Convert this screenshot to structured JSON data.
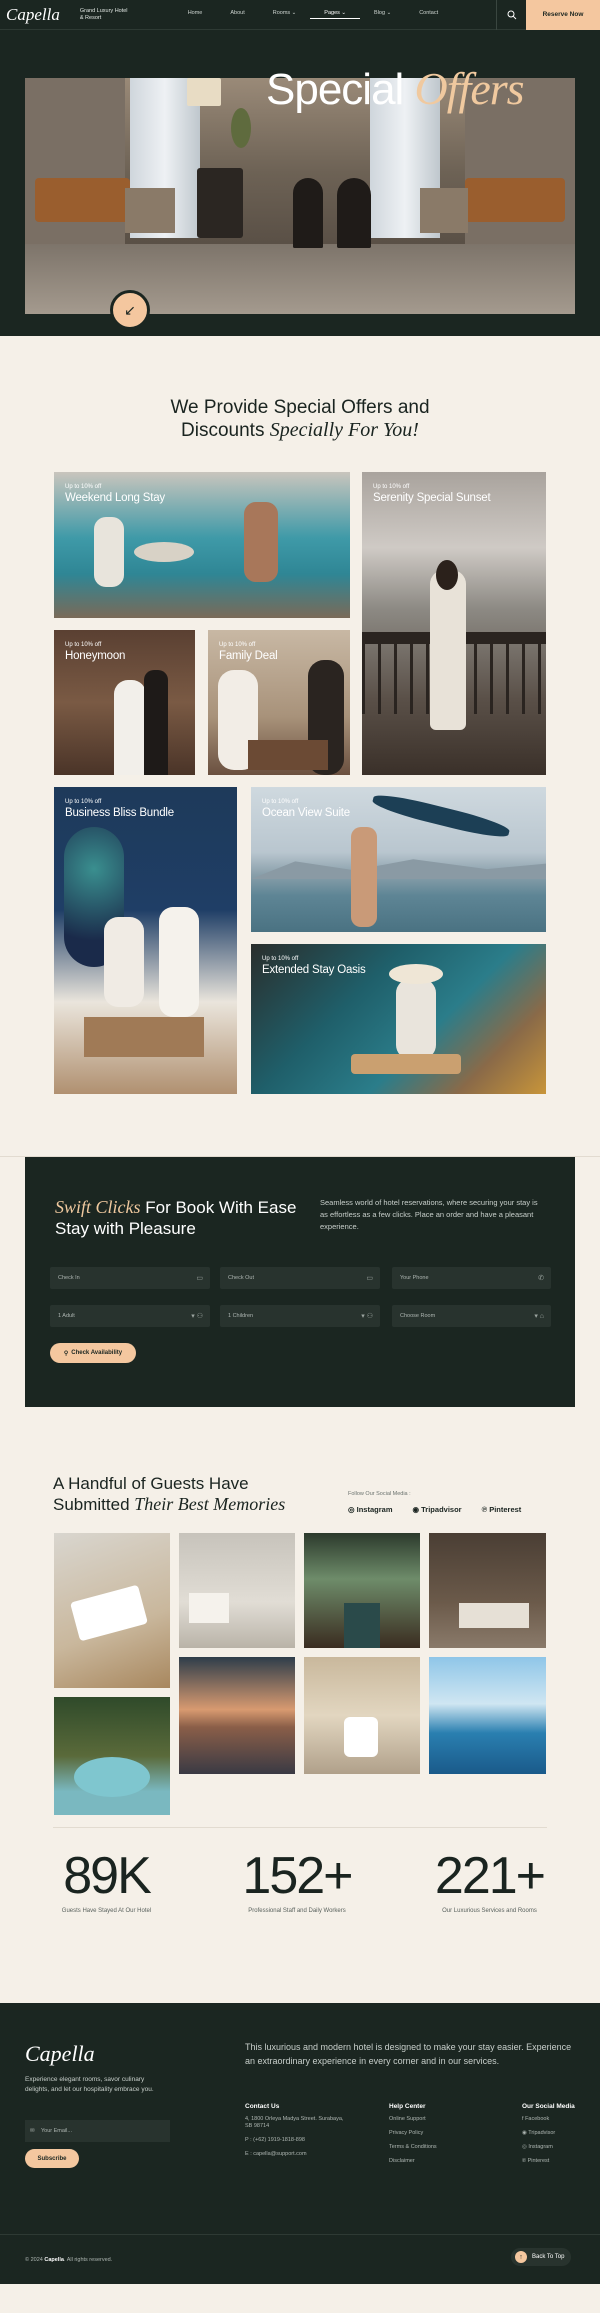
{
  "header": {
    "logo": "Capella",
    "tagline": "Grand Luxury Hotel & Resort",
    "nav": [
      "Home",
      "About",
      "Rooms ⌄",
      "Pages ⌄",
      "Blog ⌄",
      "Contact"
    ],
    "reserve": "Reserve Now"
  },
  "hero": {
    "title_plain": "Special",
    "title_italic": "Offers",
    "arrow": "↙"
  },
  "offers": {
    "heading_line1": "We Provide Special Offers and",
    "heading_line2_plain": "Discounts",
    "heading_line2_italic": "Specially For You!",
    "cards": [
      {
        "discount": "Up to 10% off",
        "name": "Weekend Long Stay"
      },
      {
        "discount": "Up to 10% off",
        "name": "Serenity Special Sunset"
      },
      {
        "discount": "Up to 10% off",
        "name": "Honeymoon"
      },
      {
        "discount": "Up to 10% off",
        "name": "Family Deal"
      },
      {
        "discount": "Up to 10% off",
        "name": "Business Bliss Bundle"
      },
      {
        "discount": "Up to 10% off",
        "name": "Ocean View Suite"
      },
      {
        "discount": "Up to 10% off",
        "name": "Extended Stay Oasis"
      }
    ]
  },
  "booking": {
    "title_italic": "Swift Clicks",
    "title_rest1": "For Book With Ease",
    "title_line2": "Stay with Pleasure",
    "description": "Seamless world of hotel reservations, where securing your stay is as effortless as a few clicks. Place an order and have a pleasant experience.",
    "check_in": "Check In",
    "check_out": "Check Out",
    "phone": "Your Phone",
    "adults": "1 Adult",
    "children": "1 Children",
    "room": "Choose Room",
    "button": "Check Availability"
  },
  "guests": {
    "line1": "A Handful of Guests Have",
    "line2_plain": "Submitted",
    "line2_italic": "Their Best Memories",
    "follow": "Follow Our Social Media :",
    "socials": [
      "Instagram",
      "Tripadvisor",
      "Pinterest"
    ]
  },
  "stats": [
    {
      "value": "89K",
      "caption": "Guests Have Stayed At Our Hotel"
    },
    {
      "value": "152+",
      "caption": "Professional Staff and Daily Workers"
    },
    {
      "value": "221+",
      "caption": "Our Luxurious Services and Rooms"
    }
  ],
  "footer": {
    "logo": "Capella",
    "description": "Experience elegant rooms, savor culinary delights, and let our hospitality embrace you.",
    "email_placeholder": "Your Email...",
    "subscribe": "Subscribe",
    "tagline": "This luxurious and modern hotel is designed to make your stay easier. Experience an extraordinary experience in every corner and in our services.",
    "contact_head": "Contact Us",
    "contact": [
      "4, 1800 Orleya Madya Street. Surabaya, SB 98714",
      "P : (+62) 1919-1818-898",
      "E : capella@support.com"
    ],
    "help_head": "Help Center",
    "help": [
      "Online Support",
      "Privacy Policy",
      "Terms & Conditions",
      "Disclaimer"
    ],
    "social_head": "Our Social Media",
    "social": [
      "Facebook",
      "Tripadvisor",
      "Instagram",
      "Pinterest"
    ],
    "copyright_pre": "© 2024",
    "copyright_brand": "Capella",
    "copyright_post": ". All rights reserved.",
    "back_to_top": "Back To Top",
    "back_arrow": "↑"
  },
  "colors": {
    "dark": "#1b2621",
    "accent": "#f4c79f",
    "cream": "#f5f0e8"
  }
}
